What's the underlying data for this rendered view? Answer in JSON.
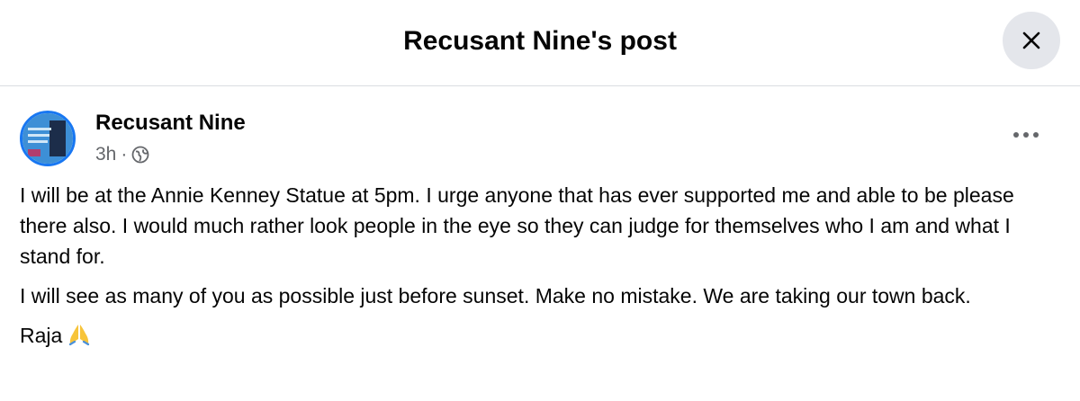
{
  "header": {
    "title": "Recusant Nine's post",
    "close_icon": "close-icon"
  },
  "post": {
    "author": "Recusant Nine",
    "timestamp": "3h",
    "separator": "·",
    "audience_icon": "globe-icon",
    "more_icon": "more-options-icon",
    "paragraphs": [
      "I will be at the Annie Kenney Statue at 5pm. I urge anyone that has ever supported me and able to be please there also. I would much rather look people in the eye so they can judge for themselves who I am and what I stand for.",
      "I will see as many of you as possible just before sunset. Make no mistake. We are taking our town back."
    ],
    "signoff": "Raja",
    "signoff_emoji": "folded-hands-icon"
  },
  "colors": {
    "accent": "#1877f2",
    "text": "#050505",
    "secondary_text": "#65676b",
    "divider": "#dadde1",
    "close_bg": "#e4e6eb"
  }
}
